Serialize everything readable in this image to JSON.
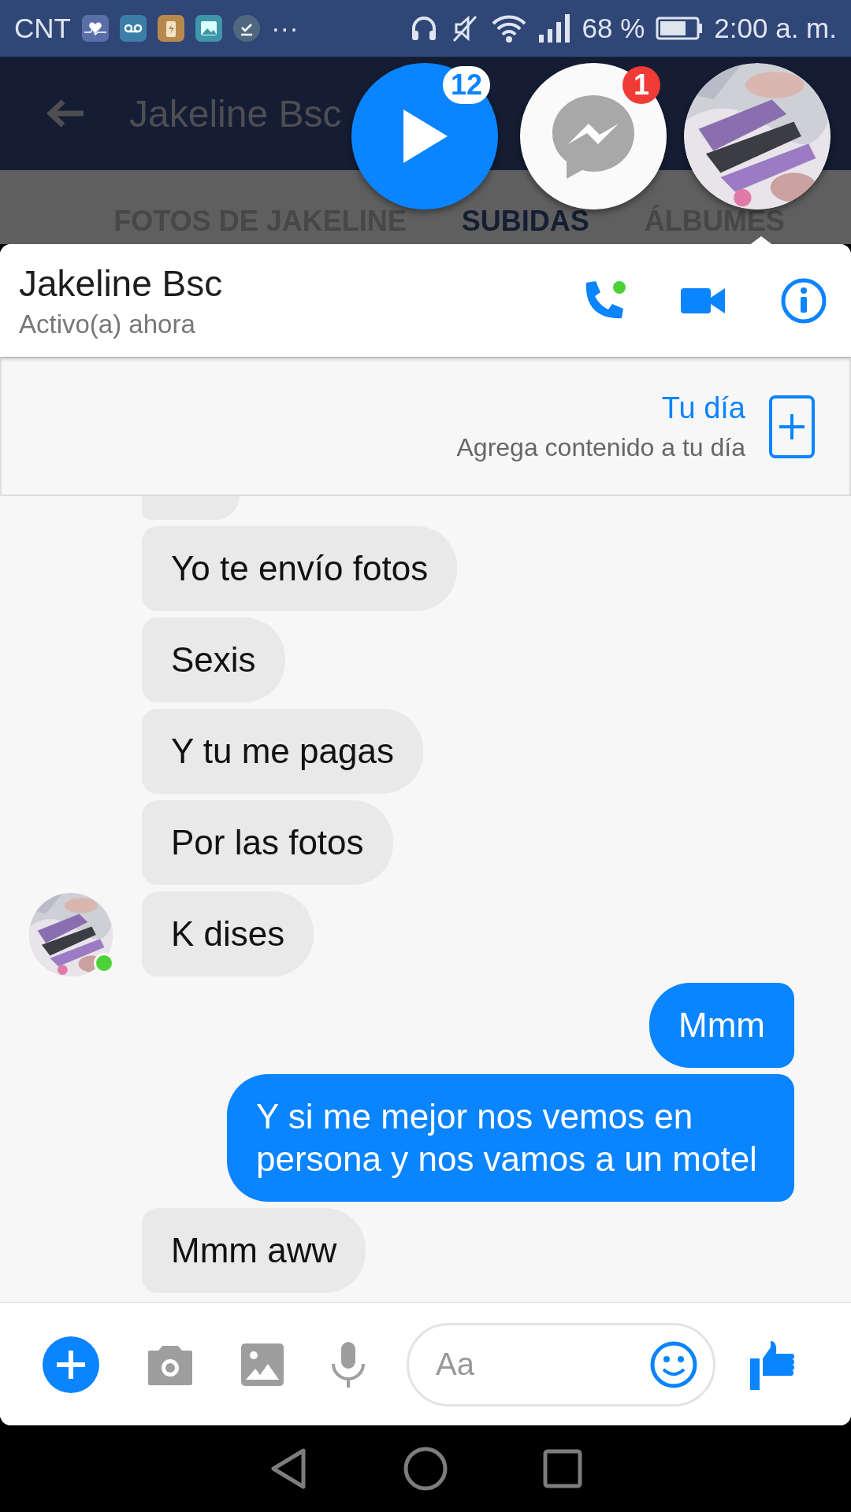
{
  "status_bar": {
    "carrier": "CNT",
    "more": "···",
    "battery": "68 %",
    "time": "2:00 a. m."
  },
  "background_app": {
    "title": "Jakeline Bsc",
    "tabs": [
      {
        "label": "FOTOS DE JAKELINE",
        "selected": false
      },
      {
        "label": "SUBIDAS",
        "selected": true
      },
      {
        "label": "ÁLBUMES",
        "selected": false
      }
    ]
  },
  "chat_heads": [
    {
      "kind": "video",
      "badge": "12"
    },
    {
      "kind": "messenger",
      "badge": "1"
    },
    {
      "kind": "avatar"
    }
  ],
  "conversation": {
    "name": "Jakeline Bsc",
    "status": "Activo(a) ahora",
    "online": true
  },
  "story": {
    "title": "Tu día",
    "subtitle": "Agrega contenido a tu día"
  },
  "messages": [
    {
      "kind": "cut"
    },
    {
      "kind": "incoming",
      "text": "Yo te envío fotos"
    },
    {
      "kind": "incoming",
      "text": "Sexis"
    },
    {
      "kind": "incoming",
      "text": "Y tu me pagas"
    },
    {
      "kind": "incoming",
      "text": "Por las fotos"
    },
    {
      "kind": "incoming",
      "text": "K dises",
      "avatar": true
    },
    {
      "kind": "outgoing",
      "text": "Mmm"
    },
    {
      "kind": "outgoing",
      "text": "Y si me mejor nos vemos en persona y nos vamos a un motel"
    },
    {
      "kind": "incoming",
      "text": "Mmm aww"
    }
  ],
  "composer": {
    "placeholder": "Aa"
  }
}
